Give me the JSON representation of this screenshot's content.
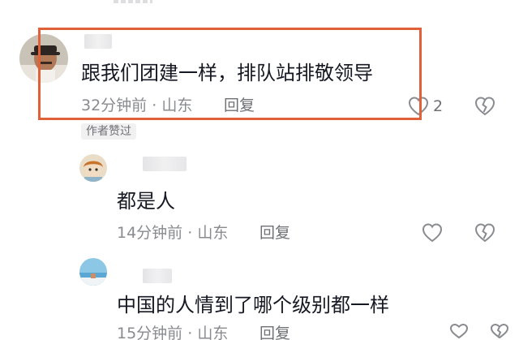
{
  "comments": [
    {
      "text": "跟我们团建一样，排队站排敬领导",
      "time": "32分钟前",
      "location": "山东",
      "reply_label": "回复",
      "likes": "2",
      "author_badge": "作者赞过"
    },
    {
      "text": "都是人",
      "time": "14分钟前",
      "location": "山东",
      "reply_label": "回复"
    },
    {
      "text": "中国的人情到了哪个级别都一样",
      "time": "15分钟前",
      "location": "山东",
      "reply_label": "回复"
    }
  ],
  "separator": "·",
  "colors": {
    "highlight": "#e0603a",
    "text": "#161823",
    "meta": "#8a8b91"
  },
  "icons": {
    "like": "heart-outline-icon",
    "dislike": "broken-heart-icon"
  }
}
